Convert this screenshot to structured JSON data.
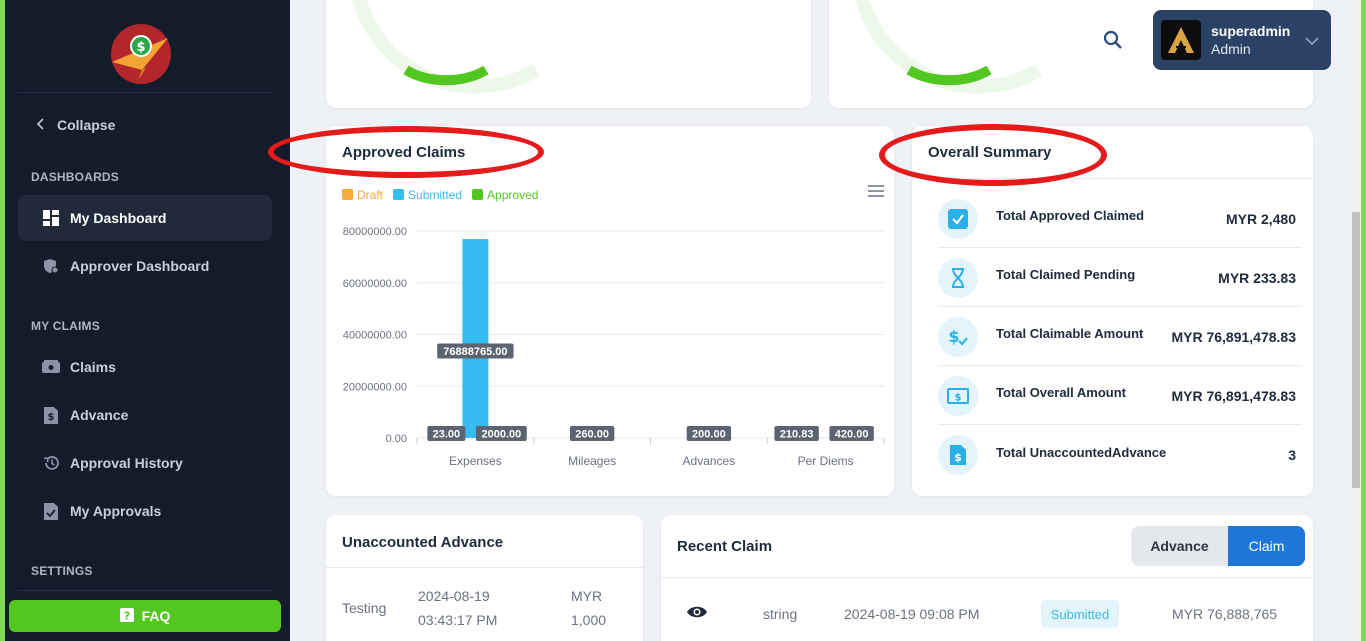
{
  "sidebar": {
    "collapse_label": "Collapse",
    "sections": {
      "dashboards": "DASHBOARDS",
      "my_claims": "MY CLAIMS",
      "settings": "SETTINGS"
    },
    "items": {
      "my_dashboard": "My Dashboard",
      "approver_dashboard": "Approver Dashboard",
      "claims": "Claims",
      "advance": "Advance",
      "approval_history": "Approval History",
      "my_approvals": "My Approvals"
    },
    "faq_label": "FAQ"
  },
  "header": {
    "user_name": "superadmin",
    "user_role": "Admin"
  },
  "approved_claims": {
    "title": "Approved Claims"
  },
  "chart_data": {
    "type": "bar",
    "title": "Approved Claims",
    "categories": [
      "Expenses",
      "Mileages",
      "Advances",
      "Per Diems"
    ],
    "series": [
      {
        "name": "Draft",
        "color": "#f7a93b",
        "values": [
          23.0,
          null,
          null,
          210.83
        ]
      },
      {
        "name": "Submitted",
        "color": "#35bdf2",
        "values": [
          76888765.0,
          260.0,
          200.0,
          420.0
        ]
      },
      {
        "name": "Approved",
        "color": "#52c71f",
        "values": [
          2000.0,
          null,
          null,
          null
        ]
      }
    ],
    "yticks": [
      "80000000.00",
      "60000000.00",
      "40000000.00",
      "20000000.00",
      "0.00"
    ],
    "ylim": [
      0,
      80000000
    ],
    "data_labels": {
      "exp_draft": "23.00",
      "exp_submitted": "76888765.00",
      "exp_approved": "2000.00",
      "mileage": "260.00",
      "advances": "200.00",
      "perdiem_draft": "210.83",
      "perdiem_submitted": "420.00"
    },
    "legend_position": "top-left",
    "grid": true
  },
  "overall_summary": {
    "title": "Overall Summary",
    "rows": [
      {
        "label": "Total Approved Claimed",
        "value": "MYR 2,480"
      },
      {
        "label": "Total Claimed Pending",
        "value": "MYR 233.83"
      },
      {
        "label": "Total Claimable Amount",
        "value": "MYR 76,891,478.83"
      },
      {
        "label": "Total Overall Amount",
        "value": "MYR 76,891,478.83"
      },
      {
        "label": "Total UnaccountedAdvance",
        "value": "3"
      }
    ]
  },
  "unaccounted_advance": {
    "title": "Unaccounted Advance",
    "row": {
      "name": "Testing",
      "date": "2024-08-19",
      "time": "03:43:17 PM",
      "currency": "MYR",
      "amount": "1,000"
    }
  },
  "recent_claim": {
    "title": "Recent Claim",
    "tabs": {
      "advance": "Advance",
      "claim": "Claim"
    },
    "row": {
      "name": "string",
      "datetime": "2024-08-19 09:08 PM",
      "status": "Submitted",
      "amount": "MYR 76,888,765"
    }
  }
}
